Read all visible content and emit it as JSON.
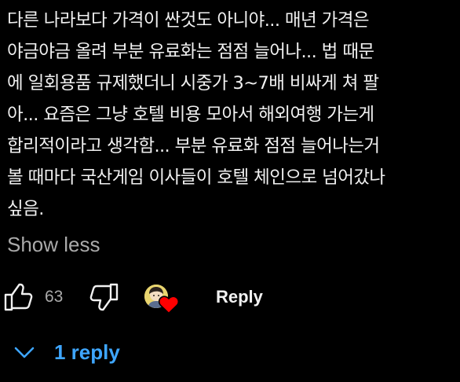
{
  "comment": {
    "lines": [
      "다른 나라보다 가격이 싼것도 아니야... 매년 가격은",
      "야금야금 올려 부분 유료화는 점점 늘어나... 법 때문",
      "에 일회용품 규제했더니 시중가 3~7배 비싸게 쳐 팔",
      "아... 요즘은 그냥 호텔 비용 모아서 해외여행 가는게",
      "합리적이라고 생각함... 부분 유료화 점점 늘어나는거",
      "볼 때마다 국산게임 이사들이 호텔 체인으로 넘어갔나",
      "싶음."
    ],
    "show_less_label": "Show less"
  },
  "actions": {
    "like_icon": "thumb-up-outline-icon",
    "like_count": "63",
    "dislike_icon": "thumb-down-outline-icon",
    "creator_heart": "heart-icon",
    "reply_label": "Reply"
  },
  "replies": {
    "toggle_icon": "chevron-down-icon",
    "label": "1 reply"
  },
  "colors": {
    "background": "#000000",
    "text_primary": "#f1f1f1",
    "text_secondary": "#aaaaaa",
    "link_blue": "#3ea6ff",
    "heart_red": "#ff0000"
  }
}
